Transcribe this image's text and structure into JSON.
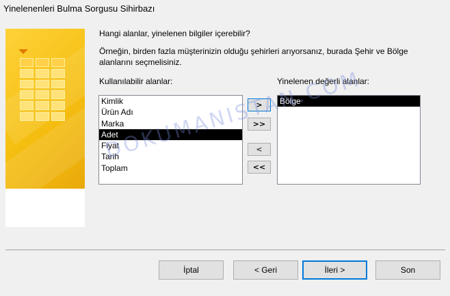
{
  "window": {
    "title": "Yinelenenleri Bulma Sorgusu Sihirbazı"
  },
  "intro": {
    "question": "Hangi alanlar, yinelenen bilgiler içerebilir?",
    "example": "Örneğin, birden fazla müşterinizin olduğu şehirleri arıyorsanız, burada Şehir ve Bölge alanlarını seçmelisiniz."
  },
  "available": {
    "label": "Kullanılabilir alanlar:",
    "items": [
      "Kimlik",
      "Ürün Adı",
      "Marka",
      "Adet",
      "Fiyat",
      "Tarih",
      "Toplam"
    ],
    "selected_index": 3
  },
  "duplicate": {
    "label": "Yinelenen değerli alanlar:",
    "items": [
      "Bölge"
    ],
    "selected_index": 0
  },
  "move_buttons": {
    "add_one": ">",
    "add_all": ">>",
    "remove_one": "<",
    "remove_all": "<<"
  },
  "footer": {
    "cancel": "İptal",
    "back": "< Geri",
    "next": "İleri >",
    "finish": "Son"
  },
  "watermark": "DOKUMANISTAN.COM",
  "colors": {
    "art_gold": "#f5bf11",
    "focus_blue": "#0078d7",
    "selection": "#000000"
  }
}
